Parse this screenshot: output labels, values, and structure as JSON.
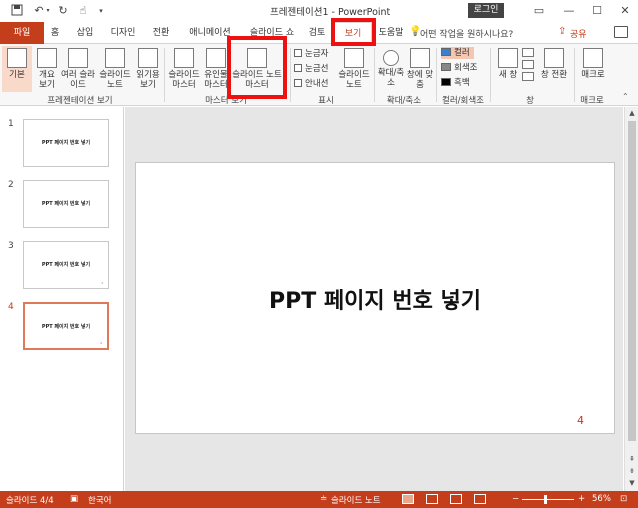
{
  "titlebar": {
    "title": "프레젠테이션1  -  PowerPoint",
    "login": "로그인",
    "qat": [
      "save-icon",
      "undo-icon",
      "redo-icon",
      "touch-mode-icon",
      "customize-icon"
    ],
    "window_controls": {
      "restore_ribbon": "▭",
      "minimize": "—",
      "maximize": "☐",
      "close": "✕"
    }
  },
  "tabs": {
    "items": [
      "파일",
      "홈",
      "삽입",
      "디자인",
      "전환",
      "애니메이션",
      "슬라이드 쇼",
      "검토",
      "보기",
      "도움말"
    ],
    "active": "보기",
    "tell_me": "어떤 작업을 원하시나요?",
    "share": "공유"
  },
  "ribbon": {
    "presentation_views": {
      "buttons": [
        "기본",
        "개요 보기",
        "여러 슬라이드",
        "슬라이드 노트",
        "읽기용 보기"
      ],
      "label": "프레젠테이션 보기"
    },
    "master_views": {
      "buttons": [
        "슬라이드 마스터",
        "유인물 마스터",
        "슬라이드 노트 마스터"
      ],
      "label": "마스터 보기"
    },
    "show": {
      "checks": [
        "눈금자",
        "눈금선",
        "안내선"
      ],
      "notes_button": "슬라이드 노트",
      "label": "표시"
    },
    "zoom": {
      "buttons": [
        "확대/축소",
        "창에 맞춤"
      ],
      "label": "확대/축소"
    },
    "color": {
      "options": [
        "컬러",
        "회색조",
        "흑백"
      ],
      "label": "컬러/회색조"
    },
    "window": {
      "buttons": [
        "새 창",
        "창 전환"
      ],
      "label": "창"
    },
    "macros": {
      "button": "매크로",
      "label": "매크로"
    }
  },
  "slides": [
    {
      "number": "1",
      "title": "PPT 페이지 번호 넣기"
    },
    {
      "number": "2",
      "title": "PPT 페이지 번호 넣기"
    },
    {
      "number": "3",
      "title": "PPT 페이지 번호 넣기"
    },
    {
      "number": "4",
      "title": "PPT 페이지 번호 넣기"
    }
  ],
  "editor": {
    "title": "PPT 페이지 번호 넣기",
    "slide_number": "4"
  },
  "status": {
    "slide_info": "슬라이드 4/4",
    "language": "한국어",
    "notes_button": "슬라이드 노트",
    "zoom": "56%"
  },
  "colors": {
    "accent": "#c43e1c",
    "highlight_box": "#ee1111",
    "slide_number": "#d0301b"
  }
}
